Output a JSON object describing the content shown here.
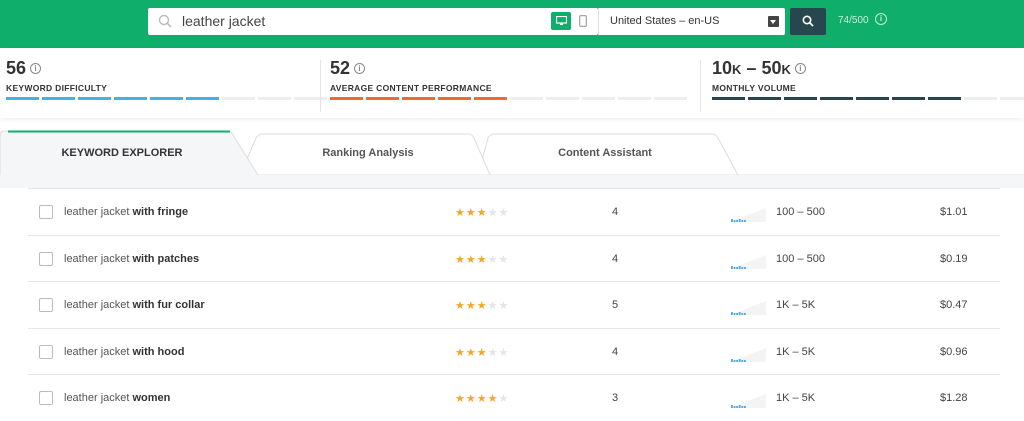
{
  "header": {
    "search_value": "leather jacket",
    "locale": "United States – en-US",
    "quota": "74/500",
    "accent": "#0fae6b"
  },
  "metrics": {
    "keyword_difficulty": {
      "value": "56",
      "label": "KEYWORD DIFFICULTY",
      "level": 0.56,
      "color": "#3fb3e8"
    },
    "content_performance": {
      "value": "52",
      "label": "AVERAGE CONTENT PERFORMANCE",
      "level": 0.52,
      "color": "#f06a2e"
    },
    "monthly_volume": {
      "value_low": "10",
      "unit_low": "K",
      "dash": " – ",
      "value_high": "50",
      "unit_high": "K",
      "label": "MONTHLY VOLUME",
      "level": 0.7,
      "color": "#26474e"
    }
  },
  "tabs": [
    {
      "label": "KEYWORD EXPLORER",
      "active": true
    },
    {
      "label": "Ranking Analysis",
      "active": false
    },
    {
      "label": "Content Assistant",
      "active": false
    }
  ],
  "rows": [
    {
      "keyword_base": "leather jacket",
      "keyword_suffix": "with fringe",
      "stars": 3,
      "results": "4",
      "volume": "100 – 500",
      "cpc": "$1.01"
    },
    {
      "keyword_base": "leather jacket",
      "keyword_suffix": "with patches",
      "stars": 3,
      "results": "4",
      "volume": "100 – 500",
      "cpc": "$0.19"
    },
    {
      "keyword_base": "leather jacket",
      "keyword_suffix": "with fur collar",
      "stars": 3,
      "results": "5",
      "volume": "1K – 5K",
      "cpc": "$0.47"
    },
    {
      "keyword_base": "leather jacket",
      "keyword_suffix": "with hood",
      "stars": 3,
      "results": "4",
      "volume": "1K – 5K",
      "cpc": "$0.96"
    },
    {
      "keyword_base": "leather jacket",
      "keyword_suffix": "women",
      "stars": 4,
      "results": "3",
      "volume": "1K – 5K",
      "cpc": "$1.28"
    }
  ],
  "icons": {
    "search": "search-icon",
    "desktop": "desktop-icon",
    "mobile": "mobile-icon",
    "info": "info-icon",
    "caret": "caret-down-icon",
    "sparkline": "trend-sparkline"
  }
}
